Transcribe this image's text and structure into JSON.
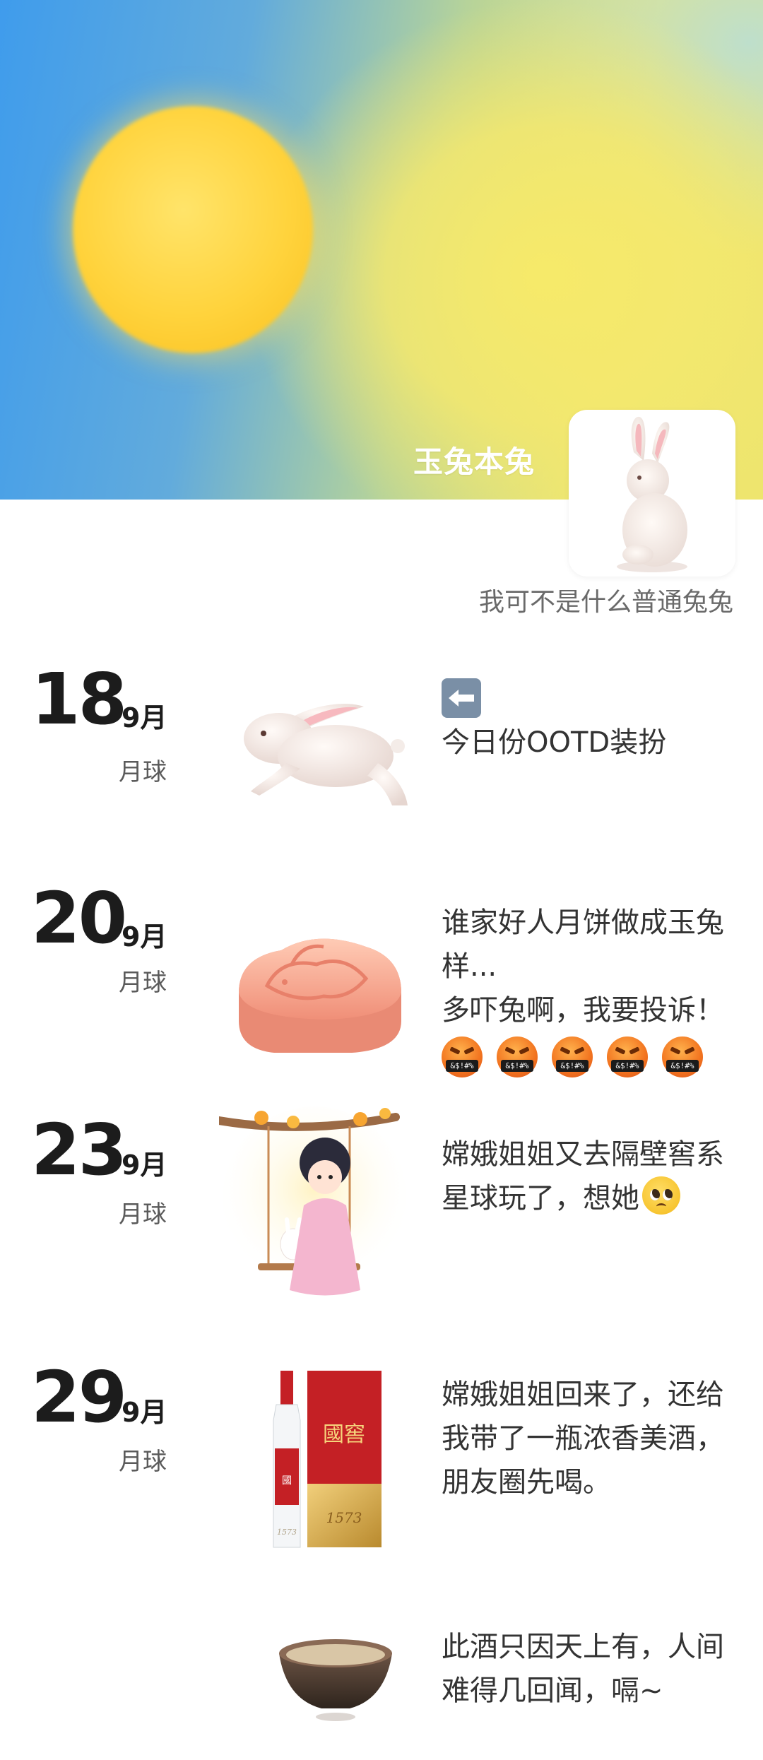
{
  "profile": {
    "username": "玉兔本兔",
    "signature": "我可不是什么普通兔兔"
  },
  "colors": {
    "sun": "#ffd33c",
    "sky_blue": "#3f9cec",
    "sky_yellow": "#eee56e"
  },
  "posts": [
    {
      "day": "18",
      "month": "9月",
      "location": "月球",
      "image": "jumping-rabbit",
      "icon": "left-arrow-icon",
      "text": "今日份OOTD装扮"
    },
    {
      "day": "20",
      "month": "9月",
      "location": "月球",
      "image": "rabbit-mooncake",
      "text_lines": [
        "谁家好人月饼做成玉兔样...",
        "多吓兔啊，我要投诉！"
      ],
      "emoji": [
        "&$!#%",
        "&$!#%",
        "&$!#%",
        "&$!#%",
        "&$!#%"
      ]
    },
    {
      "day": "23",
      "month": "9月",
      "location": "月球",
      "image": "change-on-swing",
      "text": "嫦娥姐姐又去隔壁窖系星球玩了，想她",
      "emoji_icon": "pleading-face-icon"
    },
    {
      "day": "29",
      "month": "9月",
      "location": "月球",
      "image": "guojiao-1573-baijiu",
      "brand": "國窖",
      "brand_number": "1573",
      "text": "嫦娥姐姐回来了，还给我带了一瓶浓香美酒，朋友圈先喝。"
    },
    {
      "image": "wine-cup",
      "text": "此酒只因天上有，人间难得几回闻，嗝~"
    }
  ]
}
